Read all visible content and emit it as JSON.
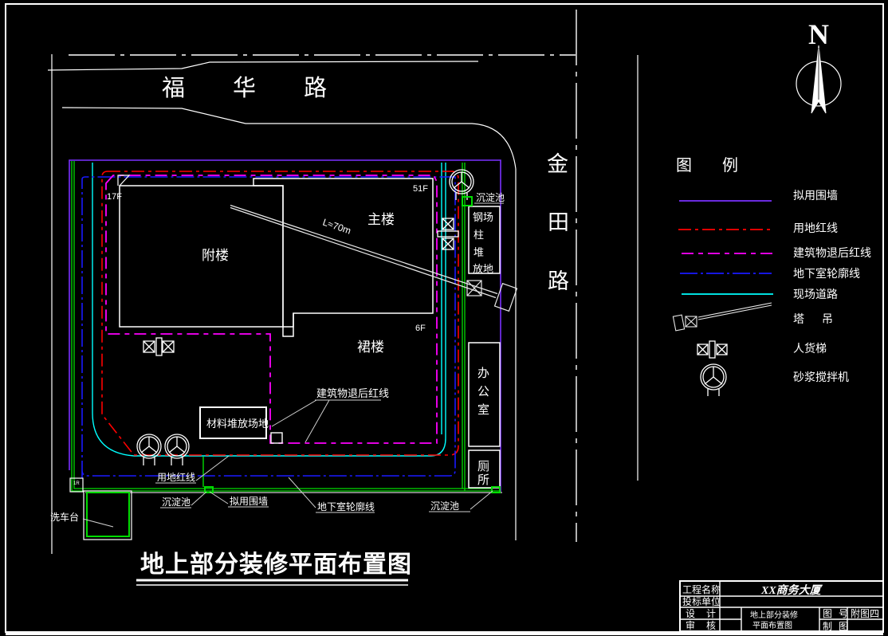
{
  "colors": {
    "background": "#000000",
    "line_white": "#ffffff",
    "fence_purple": "#7a30ff",
    "red_line": "#ff0000",
    "setback_magenta": "#ff00ff",
    "basement_blue": "#1a1aff",
    "road_cyan": "#00ffff",
    "water_green": "#00dd00"
  },
  "roads": {
    "fuhua_label": "福 华 路",
    "jintian_chars": [
      "金",
      "田",
      "路"
    ]
  },
  "north_arrow_label": "N",
  "site": {
    "annex_label": "附楼",
    "annex_floor": "17F",
    "main_label": "主楼",
    "main_floor": "51F",
    "podium_label": "裙楼",
    "podium_floor": "6F",
    "crane_length_label": "L≈70m",
    "steel_yard_lines": [
      "钢场",
      "柱",
      "堆",
      "放地"
    ],
    "office_chars": [
      "办",
      "公",
      "室"
    ],
    "toilet_chars": [
      "厕",
      "所"
    ],
    "material_area_label": "材料堆放场地",
    "setback_callout": "建筑物退后红线",
    "red_line_callout": "用地红线",
    "fence_callout": "拟用围墙",
    "basement_callout": "地下室轮廓线",
    "sediment_callout_top": "沉淀池",
    "sediment_callout_left": "沉淀池",
    "sediment_callout_right": "沉淀池",
    "carwash_label": "洗车台",
    "gate_label": "1R"
  },
  "legend": {
    "title": "图例",
    "items": [
      {
        "label": "拟用围墙",
        "style": "solid",
        "color": "#7a30ff"
      },
      {
        "label": "用地红线",
        "style": "dashed",
        "color": "#ff0000"
      },
      {
        "label": "建筑物退后红线",
        "style": "dashed",
        "color": "#ff00ff"
      },
      {
        "label": "地下室轮廓线",
        "style": "dash-dot",
        "color": "#1a1aff"
      },
      {
        "label": "现场道路",
        "style": "solid",
        "color": "#00ffff"
      },
      {
        "label": "塔吊",
        "symbol": "tower-crane"
      },
      {
        "label": "人货梯",
        "symbol": "hoist"
      },
      {
        "label": "砂浆搅拌机",
        "symbol": "mortar-mixer"
      }
    ]
  },
  "drawing_title": "地上部分装修平面布置图",
  "title_block": {
    "project_name_label": "工程名称",
    "project_name": "XX商务大厦",
    "bidder_label": "投标单位",
    "bidder": "",
    "design_label": "设计",
    "design": "",
    "review_label": "审核",
    "review": "",
    "drawing_name_line1": "地上部分装修",
    "drawing_name_line2": "平面布置图",
    "drawing_no_label": "图号",
    "drawing_no": "附图四",
    "draft_label": "制图",
    "draft": ""
  }
}
